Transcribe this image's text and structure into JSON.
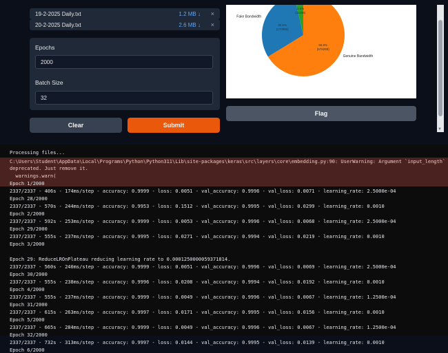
{
  "files": [
    {
      "name": "19-2-2025 Daily.txt",
      "size": "1.2 MB ↓"
    },
    {
      "name": "20-2-2025 Daily.txt",
      "size": "2.6 MB ↓"
    }
  ],
  "close_glyph": "×",
  "params": {
    "epochs_label": "Epochs",
    "epochs_value": "2000",
    "batch_label": "Batch Size",
    "batch_value": "32"
  },
  "buttons": {
    "clear": "Clear",
    "submit": "Submit",
    "flag": "Flag"
  },
  "chart_data": {
    "type": "pie",
    "slices": [
      {
        "label": "Genuine Bandwidth",
        "pct_text": "66.9%",
        "count_text": "(578289)",
        "value": 66.9,
        "color": "#ff7f0e"
      },
      {
        "label": "Fake Bandwidth",
        "pct_text": "30.5%",
        "count_text": "(170956)",
        "value": 30.5,
        "color": "#1f77b4"
      },
      {
        "label": "",
        "pct_text": "3.6%",
        "count_text": "(31186)",
        "value": 3.6,
        "color": "#2ca02c"
      }
    ]
  },
  "colors": {
    "accent": "#ea580c",
    "console_bg": "#0c0c0c",
    "warning_bg": "#4a2320"
  },
  "console": {
    "processing": "Processing files...",
    "warning": [
      "C:\\Users\\Student\\AppData\\Local\\Programs\\Python\\Python311\\Lib\\site-packages\\keras\\src\\layers\\core\\embedding.py:90: UserWarning: Argument `input_length` i",
      "deprecated. Just remove it.",
      "  warnings.warn("
    ],
    "lines": [
      "Epoch 1/2000",
      "2337/2337 - 406s - 174ms/step - accuracy: 0.9999 - loss: 0.0051 - val_accuracy: 0.9996 - val_loss: 0.0071 - learning_rate: 2.5000e-04",
      "Epoch 28/2000",
      "2337/2337 - 570s - 244ms/step - accuracy: 0.9953 - loss: 0.1512 - val_accuracy: 0.9995 - val_loss: 0.0299 - learning_rate: 0.0010",
      "Epoch 2/2000",
      "2337/2337 - 592s - 253ms/step - accuracy: 0.9999 - loss: 0.0053 - val_accuracy: 0.9996 - val_loss: 0.0068 - learning_rate: 2.5000e-04",
      "Epoch 29/2000",
      "2337/2337 - 555s - 237ms/step - accuracy: 0.9995 - loss: 0.0271 - val_accuracy: 0.9994 - val_loss: 0.0219 - learning_rate: 0.0010",
      "Epoch 3/2000",
      "",
      "Epoch 29: ReduceLROnPlateau reducing learning rate to 0.0001250000059371814.",
      "2337/2337 - 560s - 240ms/step - accuracy: 0.9999 - loss: 0.0051 - val_accuracy: 0.9996 - val_loss: 0.0069 - learning_rate: 2.5000e-04",
      "Epoch 30/2000",
      "2337/2337 - 555s - 238ms/step - accuracy: 0.9996 - loss: 0.0208 - val_accuracy: 0.9994 - val_loss: 0.0192 - learning_rate: 0.0010",
      "Epoch 4/2000",
      "2337/2337 - 555s - 237ms/step - accuracy: 0.9999 - loss: 0.0049 - val_accuracy: 0.9996 - val_loss: 0.0067 - learning_rate: 1.2500e-04",
      "Epoch 31/2000",
      "2337/2337 - 615s - 263ms/step - accuracy: 0.9997 - loss: 0.0171 - val_accuracy: 0.9995 - val_loss: 0.0156 - learning_rate: 0.0010",
      "Epoch 5/2000",
      "2337/2337 - 665s - 284ms/step - accuracy: 0.9999 - loss: 0.0049 - val_accuracy: 0.9996 - val_loss: 0.0067 - learning_rate: 1.2500e-04",
      "Epoch 32/2000",
      "2337/2337 - 732s - 313ms/step - accuracy: 0.9997 - loss: 0.0144 - val_accuracy: 0.9995 - val_loss: 0.0139 - learning_rate: 0.0010",
      "Epoch 6/2000"
    ]
  }
}
